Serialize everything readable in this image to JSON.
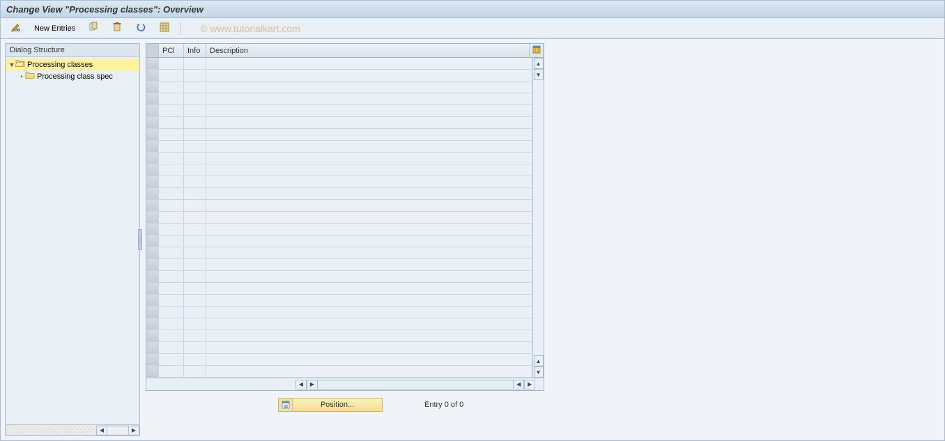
{
  "title": "Change View \"Processing classes\": Overview",
  "toolbar": {
    "new_entries_label": "New Entries"
  },
  "watermark": "© www.tutorialkart.com",
  "sidebar": {
    "header": "Dialog Structure",
    "items": [
      {
        "label": "Processing classes",
        "level": 0,
        "expanded": true,
        "selected": true,
        "open": true
      },
      {
        "label": "Processing class spec",
        "level": 1,
        "expanded": false,
        "selected": false,
        "open": false
      }
    ]
  },
  "table": {
    "columns": {
      "pcl": "PCl",
      "info": "Info",
      "description": "Description"
    },
    "row_count": 27
  },
  "footer": {
    "position_label": "Position...",
    "entry_text": "Entry 0 of 0"
  }
}
